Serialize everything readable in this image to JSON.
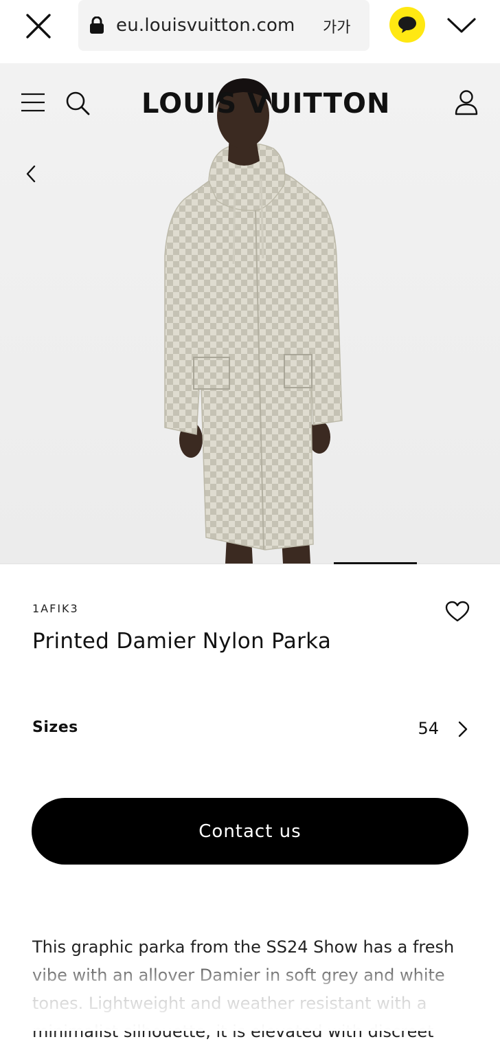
{
  "browser": {
    "url": "eu.louisvuitton.com",
    "text_size_label": "가가",
    "icons": [
      "close-icon",
      "lock-icon",
      "kakao-chat-icon",
      "chevron-down-icon"
    ],
    "colors": {
      "kakao": "#ffe812",
      "url_bar": "#f3f3f3"
    }
  },
  "header": {
    "logo": "LOUIS VUITTON",
    "icons": [
      "menu-icon",
      "search-icon",
      "account-icon",
      "back-chevron-icon"
    ]
  },
  "gallery": {
    "description": "Model wearing a long hooded parka with a light grey and white Damier check print",
    "colors": {
      "background": "#efefef",
      "check_light": "#dfdcd0",
      "check_dark": "#c3c0b2"
    }
  },
  "product": {
    "sku": "1AFIK3",
    "name": "Printed Damier Nylon Parka",
    "wishlist_icon": "heart-outline-icon",
    "sizes_label": "Sizes",
    "selected_size": "54",
    "cta_label": "Contact us",
    "description": "This graphic parka from the SS24 Show has a fresh vibe with an allover Damier in soft grey and white tones. Lightweight and weather resistant with a minimalist silhouette, it is elevated with discreet"
  }
}
